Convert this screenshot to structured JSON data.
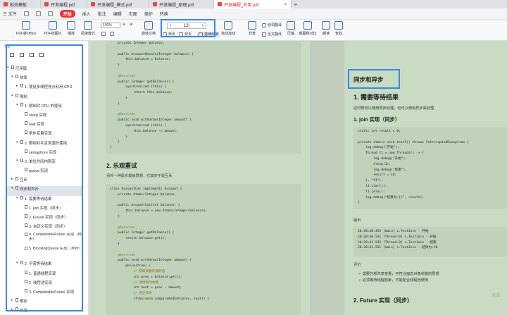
{
  "tabs": [
    {
      "label": "稻壳模板",
      "active": false,
      "icon": "docer-icon"
    },
    {
      "label": "开发编程.pdf",
      "active": false,
      "icon": "pdf-icon"
    },
    {
      "label": "开发编程_模式.pdf",
      "active": false,
      "icon": "pdf-icon"
    },
    {
      "label": "开发编程_原理.pdf",
      "active": false,
      "icon": "pdf-icon"
    },
    {
      "label": "开发编程_应用.pdf",
      "active": true,
      "icon": "pdf-icon"
    }
  ],
  "menubar": {
    "file": "三 文件",
    "items": [
      "开始",
      "插入",
      "批注",
      "编辑",
      "页面",
      "保护",
      "转换"
    ]
  },
  "toolbar": {
    "left_buttons": [
      "PDF转Office",
      "PDF转图片",
      "播放",
      "阅读模式"
    ],
    "zoom": "100%",
    "rotate": "旋转文档",
    "page_current": "12",
    "page_total": "/",
    "sub_buttons": [
      "单页",
      "双页",
      "连续阅读"
    ],
    "right_buttons": [
      "自动滚动",
      "背景",
      "划词翻译",
      "全文翻译",
      "压缩",
      "截图和对比",
      "朗读",
      "查找"
    ],
    "color_label": "色值选择"
  },
  "sidebar": {
    "title": "书签",
    "items": [
      {
        "label": "应用篇",
        "level": 0,
        "caret": "▾"
      },
      {
        "label": "效率",
        "level": 1,
        "caret": "▾"
      },
      {
        "label": "1. 使用多线程充分利用 CPU",
        "level": 2,
        "caret": "▸"
      },
      {
        "label": "限制",
        "level": 1,
        "caret": "▾"
      },
      {
        "label": "1. 限制对 CPU 的使用",
        "level": 2,
        "caret": "▾"
      },
      {
        "label": "sleep 实现",
        "level": 3,
        "caret": ""
      },
      {
        "label": "wait 实现",
        "level": 3,
        "caret": ""
      },
      {
        "label": "条件变量实现",
        "level": 3,
        "caret": ""
      },
      {
        "label": "2. 限制对共享资源的使用",
        "level": 2,
        "caret": "▾"
      },
      {
        "label": "semaphore 实现",
        "level": 3,
        "caret": ""
      },
      {
        "label": "3. 单位时间内限流",
        "level": 2,
        "caret": "▾"
      },
      {
        "label": "guava 实现",
        "level": 3,
        "caret": ""
      },
      {
        "label": "互斥",
        "level": 1,
        "caret": "▸"
      },
      {
        "label": "同步和异步",
        "level": 1,
        "caret": "▾"
      },
      {
        "label": "1. 需要等待结果",
        "level": 2,
        "caret": "▾"
      },
      {
        "label": "1. join 实现（同步）",
        "level": 3,
        "caret": ""
      },
      {
        "label": "2. Future 实现（同步）",
        "level": 3,
        "caret": ""
      },
      {
        "label": "3. 自定义实现（同步）",
        "level": 3,
        "caret": ""
      },
      {
        "label": "4. CompletableFuture 实现（异步）",
        "level": 3,
        "caret": "",
        "tall": true
      },
      {
        "label": "5. BlockingQueue 实现（异步）",
        "level": 3,
        "caret": "",
        "tall": true
      },
      {
        "label": "2. 不需等待结果",
        "level": 2,
        "caret": "▾"
      },
      {
        "label": "1. 普通线程实现",
        "level": 3,
        "caret": ""
      },
      {
        "label": "2. 线程池实现",
        "level": 3,
        "caret": ""
      },
      {
        "label": "3. CompletableFuture 实现",
        "level": 3,
        "caret": ""
      },
      {
        "label": "缓存",
        "level": 1,
        "caret": "▸"
      },
      {
        "label": "分治",
        "level": 1,
        "caret": "▸"
      }
    ]
  },
  "left_page": {
    "code_top": [
      "    private Integer balance;",
      "",
      "    public AccountUnsafe(Integer balance) {",
      "        this.balance = balance;",
      "    }",
      "",
      "    @Override",
      "    public Integer getBalance() {",
      "        synchronized (this) {",
      "            return this.balance;",
      "        }",
      "    }",
      "",
      "    @Override",
      "    public void withdraw(Integer amount) {",
      "        synchronized (this) {",
      "            this.balance -= amount;",
      "        }",
      "    }",
      "}"
    ],
    "heading": "2. 乐观重试",
    "para": "另外一种是乐观锁思想，它其实不是互斥",
    "code_bottom": [
      "class AccountCas implements Account {",
      "    private AtomicInteger balance;",
      "",
      "    public AccountCas(int balance) {",
      "        this.balance = new AtomicInteger(balance);",
      "    }",
      "",
      "    @Override",
      "    public Integer getBalance() {",
      "        return balance.get();",
      "    }",
      "",
      "    @Override",
      "    public void withdraw(Integer amount) {",
      "        while(true) {",
      "            // 获取余额的最新值",
      "            int prev = balance.get();",
      "            // 要修改的余额",
      "            int next = prev - amount;",
      "            // 真正修改",
      "            if(balance.compareAndSet(prev, next)) {"
    ]
  },
  "right_page": {
    "section_title": "同步和异步",
    "h1": "1. 需要等待结果",
    "para1": "这时既可以使用同步处理，也可以使用异步来处理",
    "h2": "1. join 实现（同步）",
    "code": [
      "static int result = 0;",
      "",
      "private static void test1() throws InterruptedException {",
      "    log.debug(\"开始\");",
      "    Thread t1 = new Thread(() -> {",
      "        log.debug(\"开始\");",
      "        sleep(1);",
      "        log.debug(\"结束\");",
      "        result = 10;",
      "    }, \"t1\");",
      "    t1.start();",
      "    t1.join();",
      "    log.debug(\"结果为:{}\", result);",
      "}"
    ],
    "output_label": "输出",
    "output": [
      "20:30:40.453 [main] c.TestJoin - 开始",
      "20:30:40.541 [Thread-0] c.TestJoin - 开始",
      "20:30:41.543 [Thread-0] c.TestJoin - 结束",
      "20:30:41.551 [main] c.TestJoin - 结果为:10"
    ],
    "eval_label": "评价",
    "bullets": [
      "需要外部共享变量，不符合面向对象封装的思想",
      "必须等待线程结束，不能配合线程池使用"
    ],
    "h3": "2. Future 实现（同步）"
  },
  "watermark": "激活"
}
